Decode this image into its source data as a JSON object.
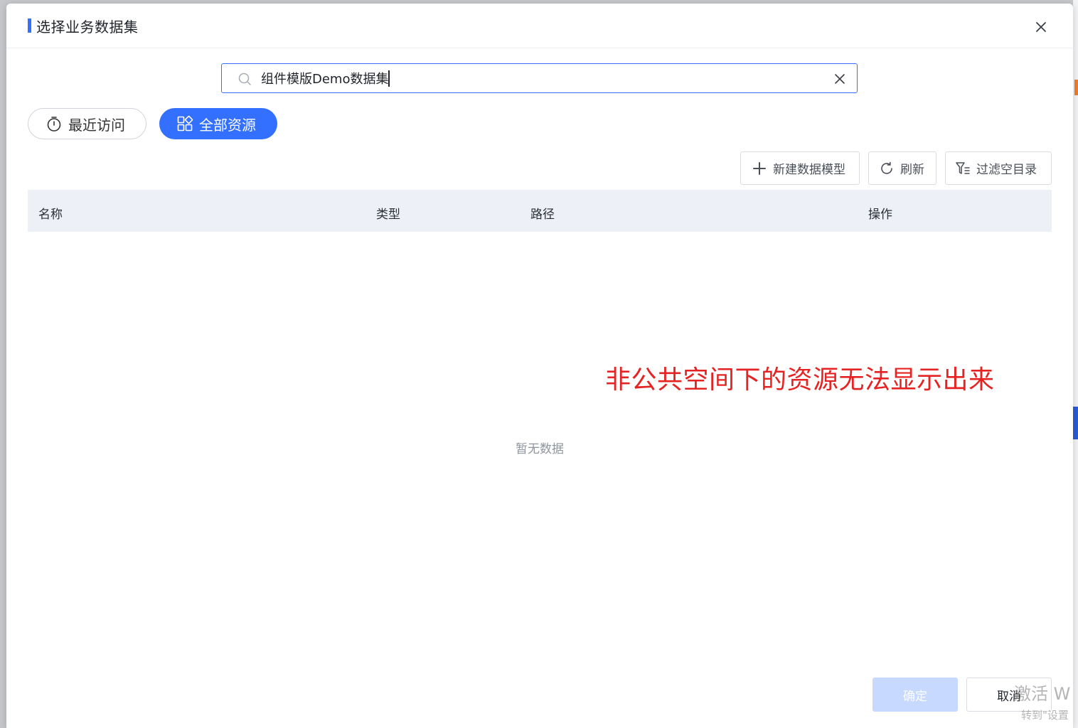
{
  "dialog": {
    "title": "选择业务数据集",
    "accent_color": "#3370ff"
  },
  "search": {
    "value": "组件模版Demo数据集",
    "placeholder": ""
  },
  "tabs": [
    {
      "label": "最近访问",
      "icon": "stopwatch-icon",
      "active": false
    },
    {
      "label": "全部资源",
      "icon": "grid-icon",
      "active": true
    }
  ],
  "toolbar": {
    "new_model_label": "新建数据模型",
    "refresh_label": "刷新",
    "filter_label": "过滤空目录"
  },
  "table": {
    "columns": [
      "名称",
      "类型",
      "路径",
      "操作"
    ],
    "rows": [],
    "empty_text": "暂无数据"
  },
  "annotation": {
    "text": "非公共空间下的资源无法显示出来",
    "color": "#e52322"
  },
  "footer": {
    "confirm_label": "确定",
    "cancel_label": "取消"
  },
  "watermark": {
    "line1": "激活 W",
    "line2": "转到\"设置"
  }
}
